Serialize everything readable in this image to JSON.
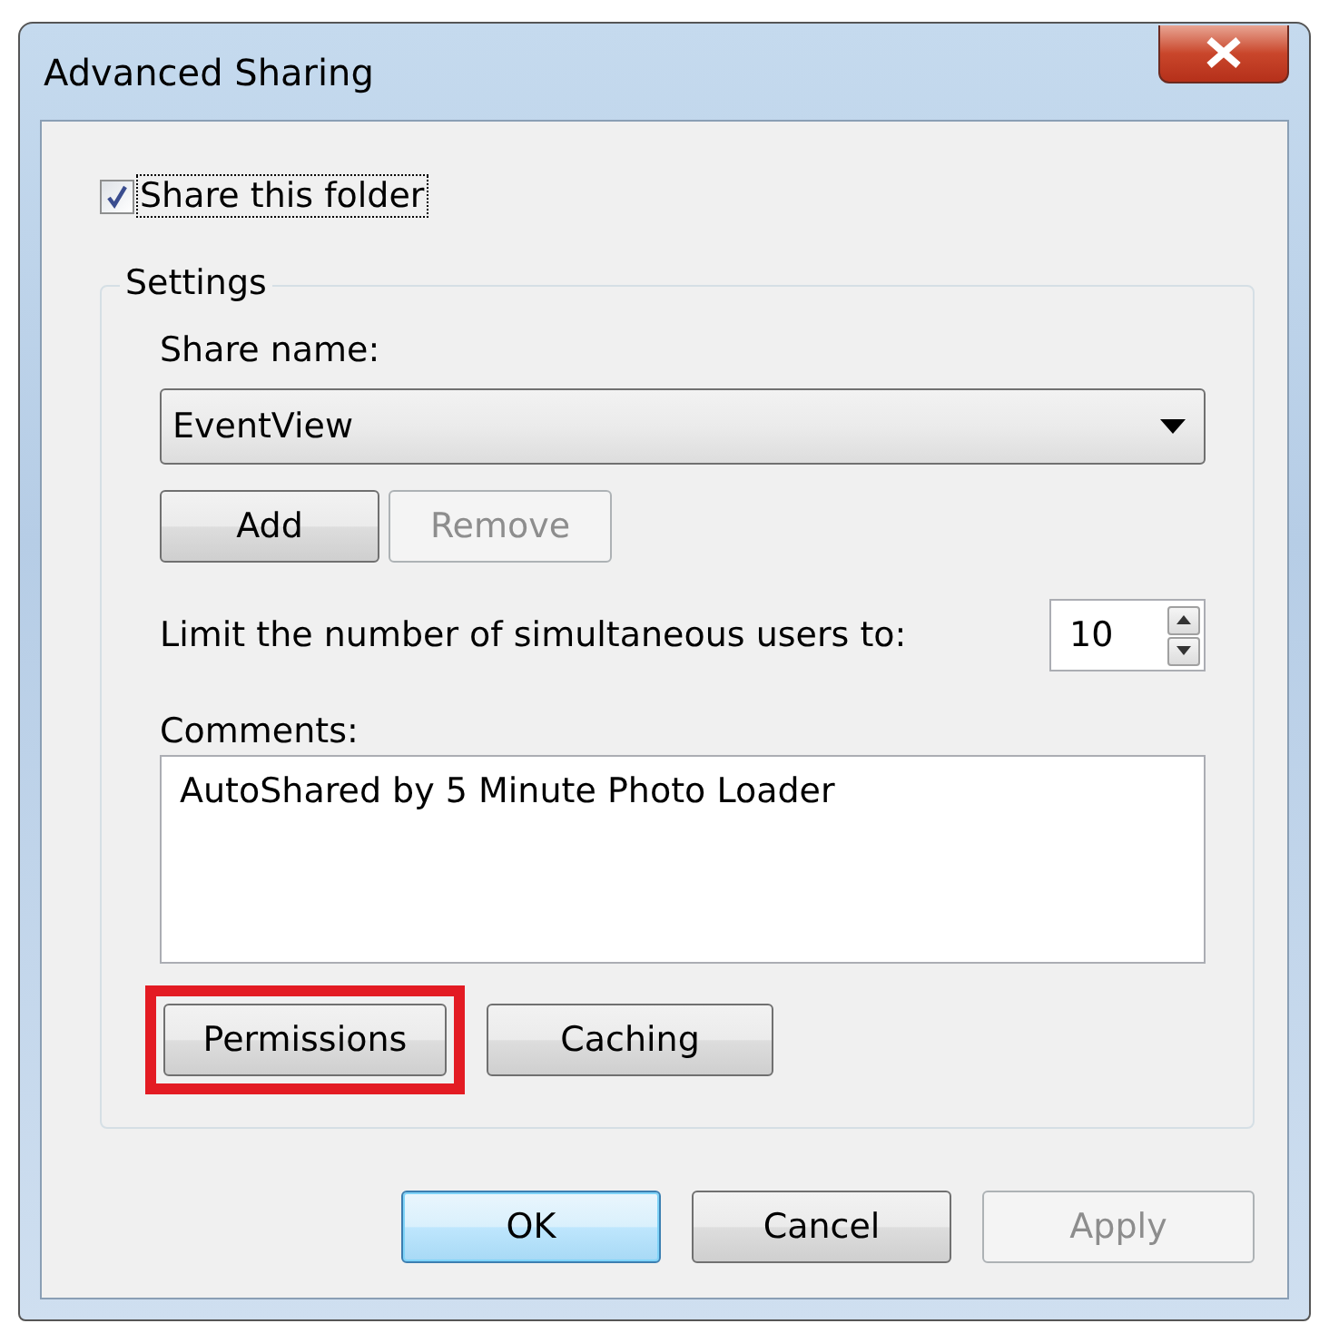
{
  "window": {
    "title": "Advanced Sharing"
  },
  "share_checkbox": {
    "label": "Share this folder",
    "checked": true,
    "focused": true
  },
  "settings": {
    "title": "Settings",
    "share_name": {
      "label": "Share name:",
      "value": "EventView"
    },
    "name_buttons": [
      {
        "label": "Add",
        "disabled": false
      },
      {
        "label": "Remove",
        "disabled": true
      }
    ],
    "limit": {
      "label": "Limit the number of simultaneous users to:",
      "value": "10"
    },
    "comments": {
      "label": "Comments:",
      "value": "AutoShared by 5 Minute Photo Loader"
    },
    "buttons": [
      {
        "label": "Permissions",
        "highlighted": true
      },
      {
        "label": "Caching",
        "highlighted": false
      }
    ]
  },
  "dialog_buttons": [
    {
      "label": "OK",
      "default": true,
      "disabled": false
    },
    {
      "label": "Cancel",
      "default": false,
      "disabled": false
    },
    {
      "label": "Apply",
      "default": false,
      "disabled": true
    }
  ]
}
